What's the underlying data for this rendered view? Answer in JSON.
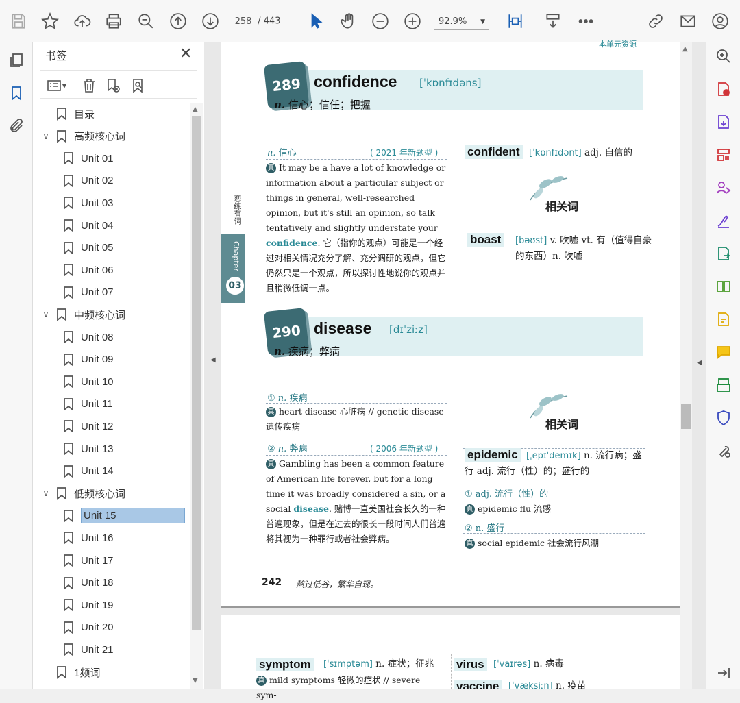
{
  "toolbar": {
    "page_current": "258",
    "page_total": "/ 443",
    "zoom": "92.9%"
  },
  "panel": {
    "title": "书签",
    "close": "✕"
  },
  "bookmarks": [
    {
      "label": "目录",
      "level": 0,
      "chevron": ""
    },
    {
      "label": "高频核心词",
      "level": 0,
      "chevron": "∨"
    },
    {
      "label": "Unit 01",
      "level": 1
    },
    {
      "label": "Unit 02",
      "level": 1
    },
    {
      "label": "Unit 03",
      "level": 1
    },
    {
      "label": "Unit 04",
      "level": 1
    },
    {
      "label": "Unit 05",
      "level": 1
    },
    {
      "label": "Unit 06",
      "level": 1
    },
    {
      "label": "Unit 07",
      "level": 1
    },
    {
      "label": "中频核心词",
      "level": 0,
      "chevron": "∨"
    },
    {
      "label": "Unit 08",
      "level": 1
    },
    {
      "label": "Unit 09",
      "level": 1
    },
    {
      "label": "Unit 10",
      "level": 1
    },
    {
      "label": "Unit 11",
      "level": 1
    },
    {
      "label": "Unit 12",
      "level": 1
    },
    {
      "label": "Unit 13",
      "level": 1
    },
    {
      "label": "Unit 14",
      "level": 1
    },
    {
      "label": "低频核心词",
      "level": 0,
      "chevron": "∨"
    },
    {
      "label": "Unit 15",
      "level": 1,
      "selected": true
    },
    {
      "label": "Unit 16",
      "level": 1
    },
    {
      "label": "Unit 17",
      "level": 1
    },
    {
      "label": "Unit 18",
      "level": 1
    },
    {
      "label": "Unit 19",
      "level": 1
    },
    {
      "label": "Unit 20",
      "level": 1
    },
    {
      "label": "Unit 21",
      "level": 1
    },
    {
      "label": "1频词",
      "level": 0,
      "chevron": ""
    }
  ],
  "page": {
    "top_label": "本单元资源",
    "side_vertical": "恋练有词",
    "chapter_label": "Chapter",
    "chapter_num": "03",
    "entry1": {
      "num": "289",
      "word": "confidence",
      "phon": "[ˈkɒnfɪdəns]",
      "pos": "n.",
      "def": "信心；信任；把握",
      "sense_pos": "n.",
      "sense": "信心",
      "year": "( 2021 年新题型 )",
      "zhen": "真",
      "en_text": "It may be a have a lot of knowledge or information about a particular subject or things in general, well-researched opinion, but it's still an opinion, so talk tentatively and slightly understate your",
      "en_hl": "confidence",
      "cn_text": ". 它（指你的观点）可能是一个经过对相关情况充分了解、充分调研的观点，但它仍然只是一个观点，所以探讨性地说你的观点并且稍微低调一点。",
      "rel1_word": "confident",
      "rel1_phon": "[ˈkɒnfɪdənt]",
      "rel1_def": "adj. 自信的",
      "rel_title": "相关词",
      "rel2_word": "boast",
      "rel2_phon": "[bəʊst]",
      "rel2_def": "v. 吹嘘 vt. 有（值得自豪的东西）n. 吹嘘"
    },
    "entry2": {
      "num": "290",
      "word": "disease",
      "phon": "[dɪˈziːz]",
      "pos": "n.",
      "def": "疾病；弊病",
      "s1_num": "1",
      "s1_pos": "n.",
      "s1": "疾病",
      "s1_text": "heart disease 心脏病 // genetic disease 遗传疾病",
      "s2_num": "2",
      "s2_pos": "n.",
      "s2": "弊病",
      "s2_year": "( 2006 年新题型 )",
      "s2_en": "Gambling has been a common feature of American life forever, but for a long time it was broadly considered a sin, or a social",
      "s2_hl": "disease",
      "s2_cn": ". 赌博一直美国社会长久的一种普遍现象，但是在过去的很长一段时间人们普遍将其视为一种罪行或者社会弊病。",
      "zhen": "真",
      "rel_title": "相关词",
      "rel_word": "epidemic",
      "rel_phon": "[ˌepɪˈdemɪk]",
      "rel_def": "n. 流行病；盛行 adj. 流行（性）的；盛行的",
      "r1_num": "1",
      "r1": "adj. 流行（性）的",
      "r1_text": "epidemic flu 流感",
      "r2_num": "2",
      "r2": "n. 盛行",
      "r2_text": "social epidemic 社会流行风潮"
    },
    "footer_num": "242",
    "footer_motto": "熬过低谷，繁华自现。"
  },
  "page2": {
    "w1": "symptom",
    "w1_phon": "[ˈsɪmptəm]",
    "w1_def": "n. 症状；征兆",
    "w1_text": "mild symptoms 轻微的症状 // severe sym-",
    "w2": "virus",
    "w2_phon": "[ˈvaɪrəs]",
    "w2_def": "n. 病毒",
    "w3": "vaccine",
    "w3_phon": "[ˈvæksiːn]",
    "w3_def": "n. 疫苗"
  },
  "colors": {
    "accent": "#2a8a96",
    "numbox": "#3c6b73",
    "band": "#dff0f2",
    "selection": "#a9c8e6"
  }
}
